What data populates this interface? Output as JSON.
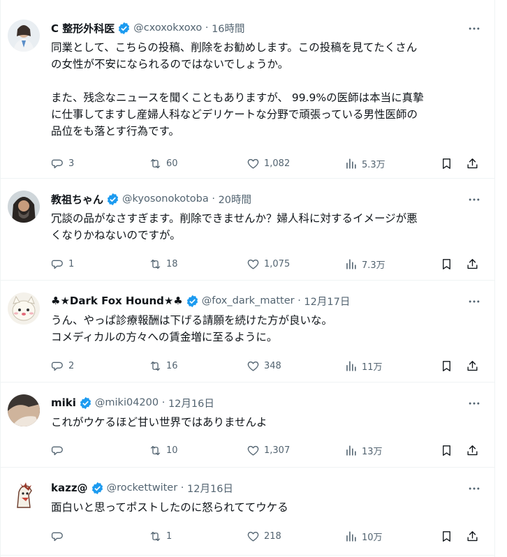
{
  "posts": [
    {
      "name": "C 整形外科医",
      "handle": "@cxoxokxoxo",
      "time": "16時間",
      "lines": [
        "同業として、こちらの投稿、削除をお勧めします。この投稿を見てたくさん",
        "の女性が不安になられるのではないでしょうか。",
        "",
        "また、残念なニュースを聞くこともありますが、 99.9%の医師は本当に真摯",
        "に仕事してますし産婦人科などデリケートな分野で頑張っている男性医師の",
        "品位をも落とす行為です。"
      ],
      "replies": "3",
      "reposts": "60",
      "likes": "1,082",
      "views": "5.3万"
    },
    {
      "name": "教祖ちゃん",
      "handle": "@kyosonokotoba",
      "time": "20時間",
      "lines": [
        "冗談の品がなさすぎます。削除できませんか？婦人科に対するイメージが悪",
        "くなりかねないのですが。"
      ],
      "replies": "1",
      "reposts": "18",
      "likes": "1,075",
      "views": "7.3万"
    },
    {
      "name": "♣★Dark Fox Hound★♣",
      "handle": "@fox_dark_matter",
      "time": "12月17日",
      "lines": [
        "うん、やっぱ診療報酬は下げる請願を続けた方が良いな。",
        "コメディカルの方々への賃金増に至るように。"
      ],
      "replies": "2",
      "reposts": "16",
      "likes": "348",
      "views": "11万"
    },
    {
      "name": "miki",
      "handle": "@miki04200",
      "time": "12月16日",
      "lines": [
        "これがウケるほど甘い世界ではありませんよ"
      ],
      "replies": "",
      "reposts": "10",
      "likes": "1,307",
      "views": "13万"
    },
    {
      "name": "kazz@",
      "handle": "@rockettwiter",
      "time": "12月16日",
      "lines": [
        "面白いと思ってポストしたのに怒られててウケる"
      ],
      "replies": "",
      "reposts": "1",
      "likes": "218",
      "views": "10万"
    }
  ],
  "colors": {
    "verified": "#1d9bf0",
    "text": "#0f1419",
    "muted": "#536471",
    "divider": "#eff3f4"
  }
}
